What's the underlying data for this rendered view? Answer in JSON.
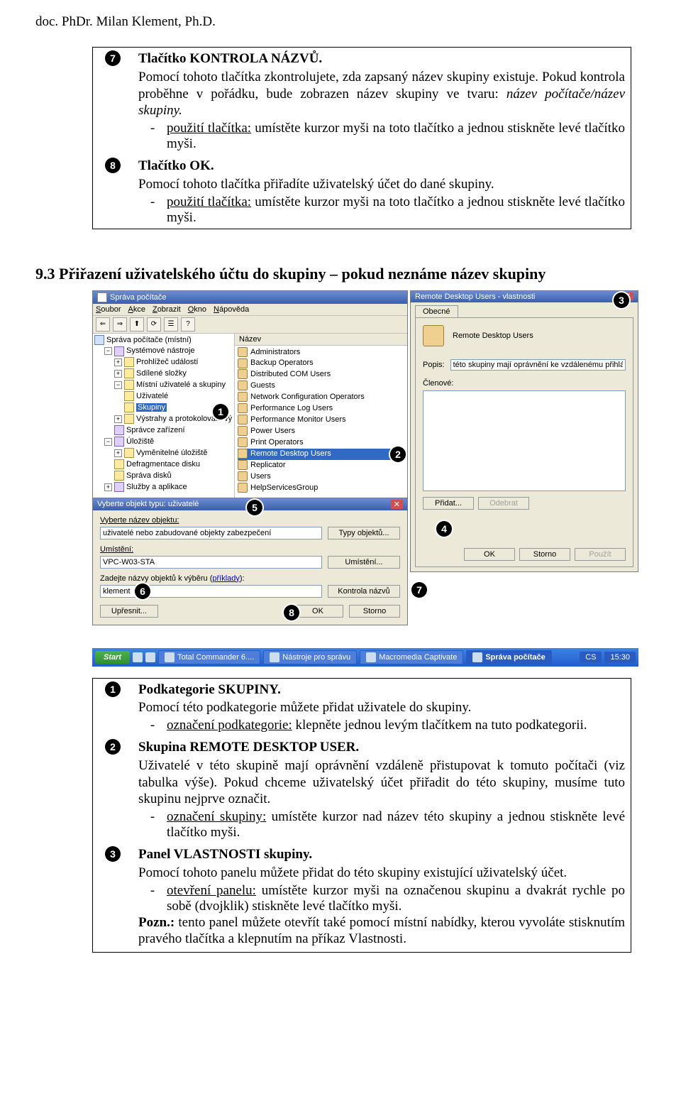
{
  "author": "doc. PhDr. Milan Klement, Ph.D.",
  "top_items": {
    "i7": {
      "num": "7",
      "title": "Tlačítko KONTROLA NÁZVŮ.",
      "p1": "Pomocí tohoto tlačítka zkontrolujete, zda zapsaný název skupiny existuje. Pokud kontrola proběhne v pořádku, bude zobrazen název skupiny ve tvaru: ",
      "p1_it": "název počítače/název skupiny.",
      "b1_lead": "použití tlačítka:",
      "b1": " umístěte kurzor myši na toto tlačítko a jednou stiskněte levé tlačítko myši."
    },
    "i8": {
      "num": "8",
      "title": "Tlačítko OK.",
      "p1": "Pomocí tohoto tlačítka přiřadíte uživatelský účet do dané skupiny.",
      "b1_lead": "použití tlačítka:",
      "b1": " umístěte kurzor myši na toto tlačítko a jednou stiskněte levé tlačítko myši."
    }
  },
  "heading": "9.3 Přiřazení uživatelského účtu do skupiny – pokud neznáme název skupiny",
  "ss": {
    "mmc_title": "Správa počítače",
    "menus": {
      "soubor": "Soubor",
      "akce": "Akce",
      "zobrazit": "Zobrazit",
      "okno": "Okno",
      "napoveda": "Nápověda"
    },
    "tree": {
      "root": "Správa počítače (místní)",
      "sys": "Systémové nástroje",
      "ev": "Prohlížeč událostí",
      "sf": "Sdílené složky",
      "lu": "Místní uživatelé a skupiny",
      "u": "Uživatelé",
      "g": "Skupiny",
      "pl": "Výstrahy a protokolování vý",
      "dm": "Správce zařízení",
      "st": "Úložiště",
      "rs": "Vyměnitelné úložiště",
      "df": "Defragmentace disku",
      "dd": "Správa disků",
      "sa": "Služby a aplikace"
    },
    "list_header": "Název",
    "groups": [
      "Administrators",
      "Backup Operators",
      "Distributed COM Users",
      "Guests",
      "Network Configuration Operators",
      "Performance Log Users",
      "Performance Monitor Users",
      "Power Users",
      "Print Operators",
      "Remote Desktop Users",
      "Replicator",
      "Users",
      "HelpServicesGroup"
    ],
    "props": {
      "title": "Remote Desktop Users - vlastnosti",
      "tab": "Obecné",
      "name": "Remote Desktop Users",
      "popis_label": "Popis:",
      "popis_value": "této skupiny mají oprávnění ke vzdálenému přihlášení.",
      "clen_label": "Členové:",
      "btn_pridat": "Přidat...",
      "btn_odebrat": "Odebrat",
      "btn_ok": "OK",
      "btn_storno": "Storno",
      "btn_pouzit": "Použít"
    },
    "dlg": {
      "title": "Vyberte objekt typu: uživatelé",
      "l1": "Vyberte název objektu:",
      "v1": "uživatelé nebo zabudované objekty zabezpečení",
      "b1": "Typy objektů...",
      "l2": "Umístění:",
      "v2": "VPC-W03-STA",
      "b2": "Umístění...",
      "l3_a": "Zadejte názvy objektů k výběru (",
      "l3_b": "příklady",
      "l3_c": "):",
      "v3": "klement",
      "b3": "Kontrola názvů",
      "btn_upresnit": "Upřesnit...",
      "btn_ok": "OK",
      "btn_storno": "Storno"
    },
    "taskbar": {
      "start": "Start",
      "t1": "Total Commander 6....",
      "t2": "Nástroje pro správu",
      "t3": "Macromedia Captivate",
      "t4": "Správa počítače",
      "lang": "CS",
      "time": "15:30"
    },
    "ovl": {
      "n1": "1",
      "n2": "2",
      "n3": "3",
      "n4": "4",
      "n5": "5",
      "n6": "6",
      "n7": "7",
      "n8": "8"
    }
  },
  "bottom_items": {
    "i1": {
      "num": "1",
      "title": "Podkategorie SKUPINY.",
      "p1": "Pomocí této podkategorie můžete přidat uživatele do skupiny.",
      "b1_lead": "označení podkategorie:",
      "b1": " klepněte jednou levým tlačítkem na tuto podkategorii."
    },
    "i2": {
      "num": "2",
      "title": "Skupina REMOTE DESKTOP USER.",
      "p1": "Uživatelé v této skupině mají oprávnění vzdáleně přistupovat k tomuto počítači (viz tabulka výše). Pokud chceme uživatelský účet přiřadit do této skupiny, musíme tuto skupinu nejprve označit.",
      "b1_lead": "označení skupiny:",
      "b1": " umístěte kurzor nad název této skupiny a jednou stiskněte levé tlačítko myši."
    },
    "i3": {
      "num": "3",
      "title": "Panel VLASTNOSTI skupiny.",
      "p1": "Pomocí tohoto panelu můžete přidat do této skupiny existující uživatelský účet.",
      "b1_lead": "otevření panelu:",
      "b1": " umístěte kurzor myši na označenou skupinu a dvakrát rychle po sobě (dvojklik) stiskněte levé tlačítko myši.",
      "pozna": "Pozn.:",
      "poznb": " tento panel můžete otevřít také pomocí místní nabídky, kterou vyvoláte stisknutím pravého tlačítka a klepnutím na příkaz Vlastnosti."
    }
  }
}
